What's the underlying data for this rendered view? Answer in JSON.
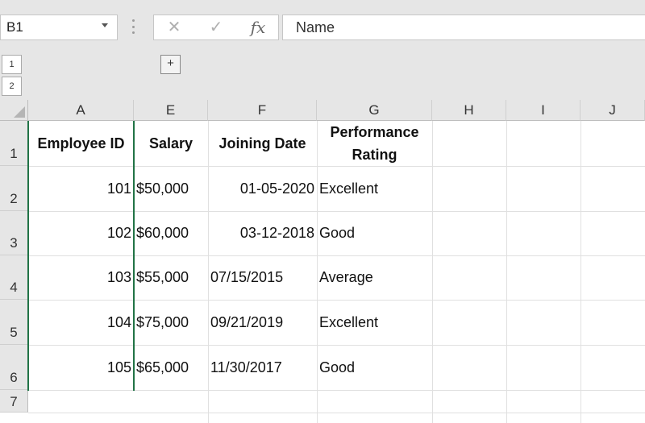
{
  "name_box": {
    "value": "B1"
  },
  "formula_bar": {
    "cancel_icon": "✕",
    "enter_icon": "✓",
    "fx_icon": "fx",
    "content": "Name"
  },
  "outline": {
    "level1": "1",
    "level2": "2",
    "expand": "+"
  },
  "columns": [
    "A",
    "E",
    "F",
    "G",
    "H",
    "I",
    "J"
  ],
  "rows": [
    "1",
    "2",
    "3",
    "4",
    "5",
    "6",
    "7"
  ],
  "header_row": {
    "employee_id": "Employee ID",
    "salary": "Salary",
    "joining_date": "Joining Date",
    "performance_line1": "Performance",
    "performance_line2": "Rating"
  },
  "data": [
    {
      "employee_id": "101",
      "salary": "$50,000",
      "joining_date": "01-05-2020",
      "rating": "Excellent"
    },
    {
      "employee_id": "102",
      "salary": "$60,000",
      "joining_date": "03-12-2018",
      "rating": "Good"
    },
    {
      "employee_id": "103",
      "salary": "$55,000",
      "joining_date": "07/15/2015",
      "rating": "Average"
    },
    {
      "employee_id": "104",
      "salary": "$75,000",
      "joining_date": "09/21/2019",
      "rating": "Excellent"
    },
    {
      "employee_id": "105",
      "salary": "$65,000",
      "joining_date": "11/30/2017",
      "rating": "Good"
    }
  ],
  "colors": {
    "selection": "#217346",
    "header_bg": "#e6e6e6",
    "gridline": "#e0e0e0"
  }
}
